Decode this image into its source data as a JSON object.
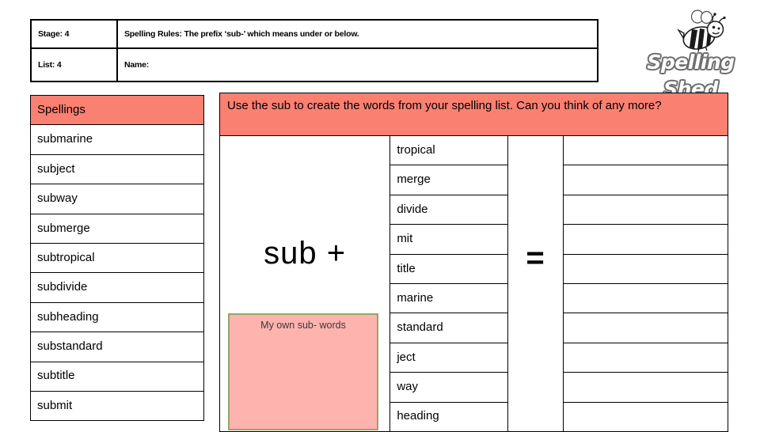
{
  "header": {
    "stage_label": "Stage: 4",
    "list_label": "List: 4",
    "rules_label": "Spelling Rules:  The prefix ‘sub-’ which means under or below.",
    "name_label": "Name:"
  },
  "logo": {
    "wordmark": "Spelling Shed",
    "bee_icon": "bee-icon"
  },
  "spellings": {
    "heading": "Spellings",
    "words": [
      "submarine",
      "subject",
      "subway",
      "submerge",
      "subtropical",
      "subdivide",
      "subheading",
      "substandard",
      "subtitle",
      "submit"
    ]
  },
  "activity": {
    "instruction": "Use the sub to create the words from your spelling list. Can you think of any more?",
    "prefix_label": "sub +",
    "own_words_label": "My own sub- words",
    "equals_label": "=",
    "root_words": [
      "tropical",
      "merge",
      "divide",
      "mit",
      "title",
      "marine",
      "standard",
      "ject",
      "way",
      "heading"
    ],
    "answers": [
      "",
      "",
      "",
      "",
      "",
      "",
      "",
      "",
      "",
      ""
    ]
  },
  "colors": {
    "salmon": "#fa8072",
    "light_pink": "#ffb3ae",
    "olive_border": "#94a56a",
    "ink": "#000000"
  }
}
